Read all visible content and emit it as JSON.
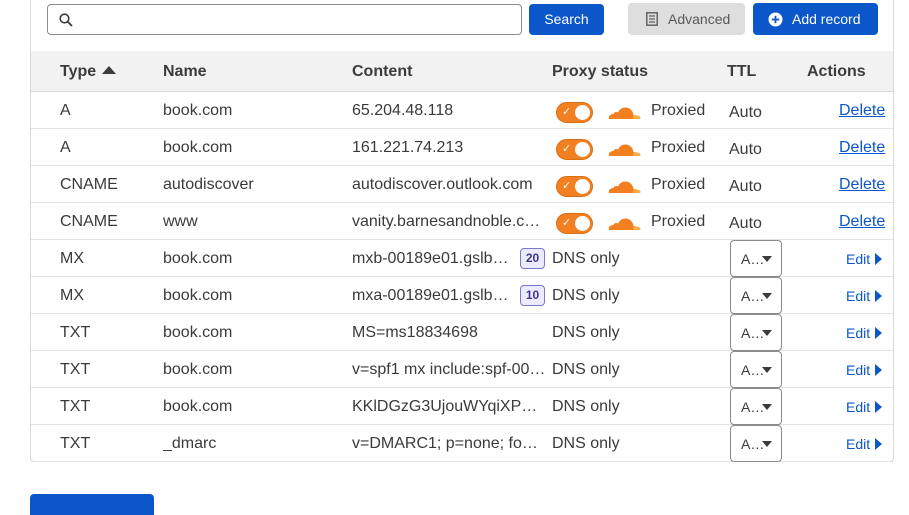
{
  "toolbar": {
    "search_placeholder": "",
    "search_label": "Search",
    "advanced_label": "Advanced",
    "add_record_label": "Add record"
  },
  "table": {
    "headers": {
      "type": "Type",
      "name": "Name",
      "content": "Content",
      "proxy_status": "Proxy status",
      "ttl": "TTL",
      "actions": "Actions"
    },
    "sort": {
      "column": "Type",
      "direction": "ascending"
    },
    "rows": [
      {
        "type": "A",
        "name": "book.com",
        "content": "65.204.48.118",
        "proxy": "Proxied",
        "proxied": true,
        "ttl": "Auto",
        "action": "Delete"
      },
      {
        "type": "A",
        "name": "book.com",
        "content": "161.221.74.213",
        "proxy": "Proxied",
        "proxied": true,
        "ttl": "Auto",
        "action": "Delete"
      },
      {
        "type": "CNAME",
        "name": "autodiscover",
        "content": "autodiscover.outlook.com",
        "proxy": "Proxied",
        "proxied": true,
        "ttl": "Auto",
        "action": "Delete"
      },
      {
        "type": "CNAME",
        "name": "www",
        "content": "vanity.barnesandnoble.c…",
        "proxy": "Proxied",
        "proxied": true,
        "ttl": "Auto",
        "action": "Delete"
      },
      {
        "type": "MX",
        "name": "book.com",
        "content": "mxb-00189e01.gslb.p…",
        "priority": "20",
        "proxy": "DNS only",
        "proxied": false,
        "ttl": "A…",
        "action": "Edit"
      },
      {
        "type": "MX",
        "name": "book.com",
        "content": "mxa-00189e01.gslb.p…",
        "priority": "10",
        "proxy": "DNS only",
        "proxied": false,
        "ttl": "A…",
        "action": "Edit"
      },
      {
        "type": "TXT",
        "name": "book.com",
        "content": "MS=ms18834698",
        "proxy": "DNS only",
        "proxied": false,
        "ttl": "A…",
        "action": "Edit"
      },
      {
        "type": "TXT",
        "name": "book.com",
        "content": "v=spf1 mx include:spf-00…",
        "proxy": "DNS only",
        "proxied": false,
        "ttl": "A…",
        "action": "Edit"
      },
      {
        "type": "TXT",
        "name": "book.com",
        "content": "KKlDGzG3UjouWYqiXPEi…",
        "proxy": "DNS only",
        "proxied": false,
        "ttl": "A…",
        "action": "Edit"
      },
      {
        "type": "TXT",
        "name": "_dmarc",
        "content": "v=DMARC1; p=none; fo=…",
        "proxy": "DNS only",
        "proxied": false,
        "ttl": "A…",
        "action": "Edit"
      }
    ]
  },
  "colors": {
    "primary": "#0b57c9",
    "proxy_orange": "#f38020",
    "header_bg": "#f2f2f2"
  },
  "icons": {
    "search": "search-icon",
    "advanced": "document-icon",
    "add": "plus-circle-icon",
    "cloud": "cloud-icon",
    "sort": "sort-ascending-icon",
    "dropdown": "chevron-down-icon",
    "edit_expand": "caret-right-icon"
  }
}
